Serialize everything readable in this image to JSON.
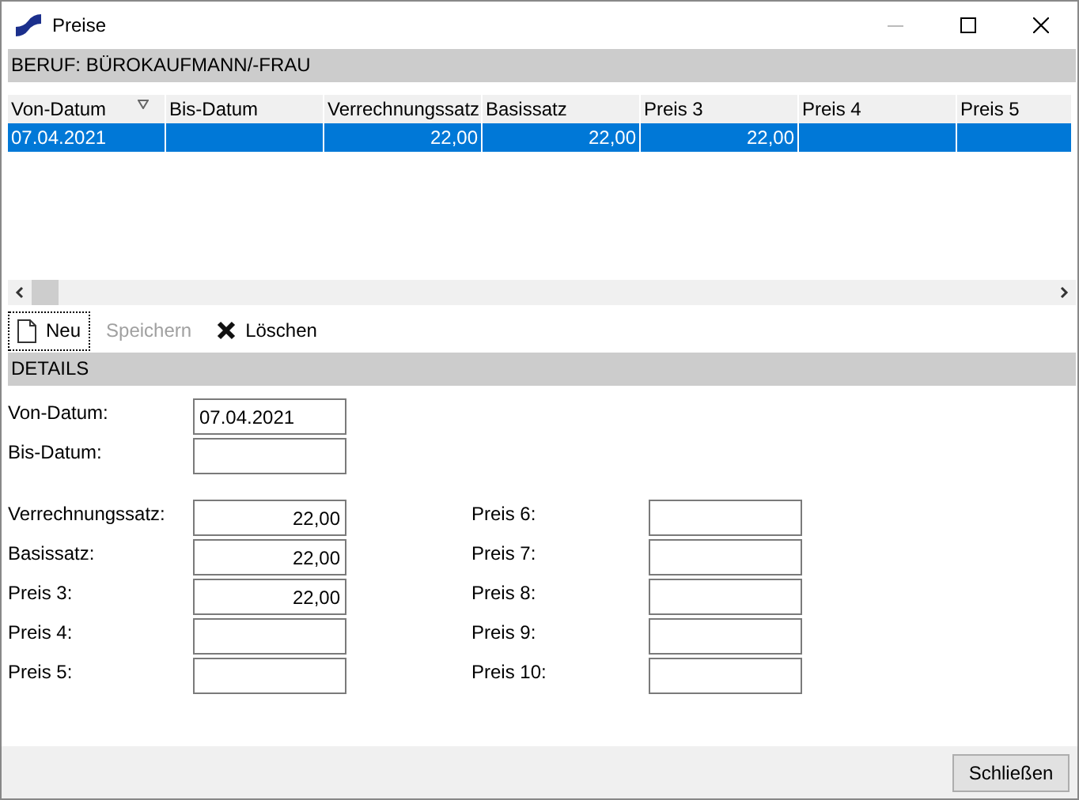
{
  "window": {
    "title": "Preise"
  },
  "section": {
    "title": "BERUF: BÜROKAUFMANN/-FRAU"
  },
  "table": {
    "columns": [
      {
        "label": "Von-Datum",
        "sorted": true
      },
      {
        "label": "Bis-Datum",
        "sorted": false
      },
      {
        "label": "Verrechnungssatz",
        "sorted": false
      },
      {
        "label": "Basissatz",
        "sorted": false
      },
      {
        "label": "Preis 3",
        "sorted": false
      },
      {
        "label": "Preis 4",
        "sorted": false
      },
      {
        "label": "Preis 5",
        "sorted": false
      }
    ],
    "rows": [
      {
        "selected": true,
        "cells": [
          "07.04.2021",
          "",
          "22,00",
          "22,00",
          "22,00",
          "",
          ""
        ]
      }
    ]
  },
  "toolbar": [
    {
      "label": "Neu",
      "kind": "new",
      "disabled": false,
      "focused": true
    },
    {
      "label": "Speichern",
      "kind": "save",
      "disabled": true,
      "focused": false
    },
    {
      "label": "Löschen",
      "kind": "delete",
      "disabled": false,
      "focused": false
    }
  ],
  "details": {
    "title": "DETAILS",
    "dates": [
      {
        "label": "Von-Datum:",
        "value": "07.04.2021"
      },
      {
        "label": "Bis-Datum:"
      }
    ],
    "left": [
      {
        "label": "Verrechnungssatz:",
        "value": "22,00"
      },
      {
        "label": "Basissatz:",
        "value": "22,00"
      },
      {
        "label": "Preis 3:",
        "value": "22,00"
      },
      {
        "label": "Preis 4:"
      },
      {
        "label": "Preis 5:"
      }
    ],
    "right": [
      {
        "label": "Preis 6:"
      },
      {
        "label": "Preis 7:"
      },
      {
        "label": "Preis 8:"
      },
      {
        "label": "Preis 9:"
      },
      {
        "label": "Preis 10:"
      }
    ]
  },
  "footer": {
    "close_button": "Schließen"
  }
}
